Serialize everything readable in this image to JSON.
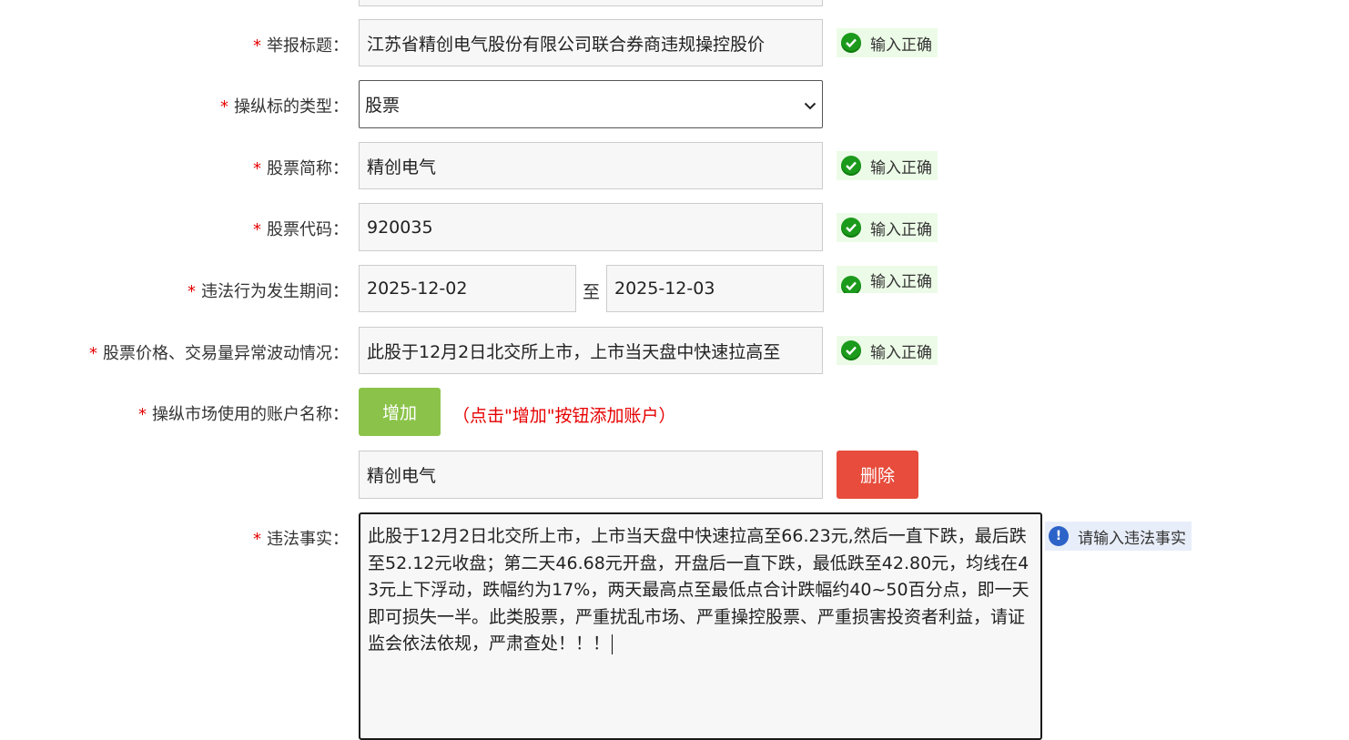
{
  "required_mark": "*",
  "fields": {
    "title": {
      "label": "举报标题：",
      "value": "江苏省精创电气股份有限公司联合券商违规操控股价",
      "status": "输入正确"
    },
    "type": {
      "label": "操纵标的类型：",
      "value": "股票"
    },
    "stock_name": {
      "label": "股票简称：",
      "value": "精创电气",
      "status": "输入正确"
    },
    "stock_code": {
      "label": "股票代码：",
      "value": "920035",
      "status": "输入正确"
    },
    "period": {
      "label": "违法行为发生期间：",
      "start": "2025-12-02",
      "sep": "至",
      "end": "2025-12-03",
      "status": "输入正确"
    },
    "abnormal": {
      "label": "股票价格、交易量异常波动情况：",
      "value": "此股于12月2日北交所上市，上市当天盘中快速拉高至",
      "status": "输入正确"
    },
    "accounts": {
      "label": "操纵市场使用的账户名称：",
      "add_label": "增加",
      "hint": "（点击\"增加\"按钮添加账户）",
      "items": [
        {
          "value": "精创电气",
          "delete_label": "删除"
        }
      ]
    },
    "facts": {
      "label": "违法事实：",
      "value": "此股于12月2日北交所上市，上市当天盘中快速拉高至66.23元,然后一直下跌，最后跌至52.12元收盘；第二天46.68元开盘，开盘后一直下跌，最低跌至42.80元，均线在43元上下浮动，跌幅约为17%，两天最高点至最低点合计跌幅约40~50百分点，即一天即可损失一半。此类股票，严重扰乱市场、严重操控股票、严重损害投资者利益，请证监会依法依规，严肃查处！！！",
      "status": "请输入违法事实"
    }
  },
  "icons": {
    "ok": "check-circle-icon",
    "info": "info-circle-icon",
    "select": "chevron-down-icon"
  },
  "colors": {
    "required": "#e60000",
    "ok_bg": "#ecfbe7",
    "ok_icon": "#1c9a1c",
    "info_bg": "#e8eef9",
    "info_icon": "#2c63c8",
    "add_button": "#8bc34a",
    "delete_button": "#e74c3c"
  }
}
